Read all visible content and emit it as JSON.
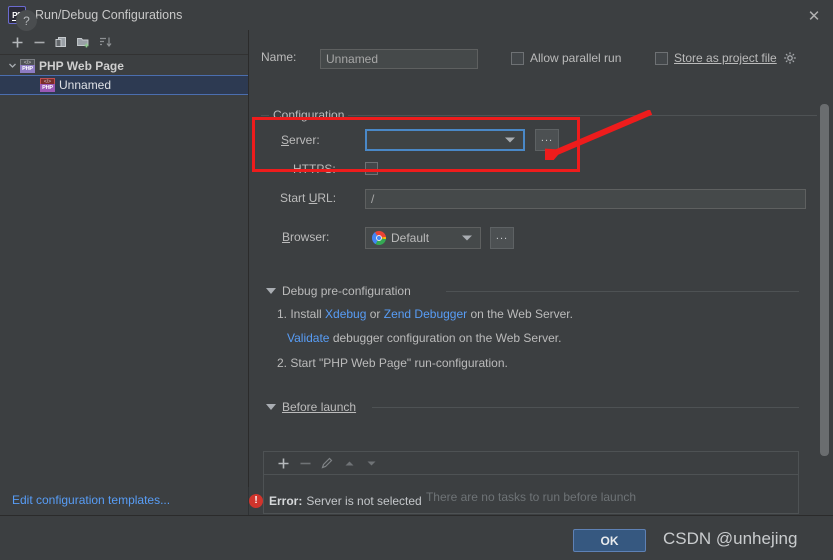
{
  "window": {
    "title": "Run/Debug Configurations",
    "app_icon": "phpstorm-icon",
    "close_icon": "✕"
  },
  "left_panel": {
    "toolbar": [
      {
        "name": "add-configuration-button",
        "icon": "plus-icon",
        "label": "+"
      },
      {
        "name": "remove-configuration-button",
        "icon": "minus-icon",
        "label": "−"
      },
      {
        "name": "copy-configuration-button",
        "icon": "copy-icon",
        "label": "copy"
      },
      {
        "name": "save-configuration-button",
        "icon": "save-folder-icon",
        "label": "save"
      },
      {
        "name": "sort-configurations-button",
        "icon": "sort-icon",
        "label": "sort"
      }
    ],
    "tree": [
      {
        "label": "PHP Web Page",
        "type": "group",
        "expanded": true,
        "icon": "php-web-page-icon"
      },
      {
        "label": "Unnamed",
        "type": "child",
        "selected": true,
        "icon": "php-web-page-icon"
      }
    ],
    "edit_templates_link": "Edit configuration templates..."
  },
  "form": {
    "name_label": "Name:",
    "name_value": "Unnamed",
    "name_placeholder": "Unnamed",
    "allow_parallel_run": "Allow parallel run",
    "allow_parallel_run_checked": false,
    "store_as_project_file": "Store as project file",
    "store_as_project_file_checked": false,
    "store_gear_icon": "gear-icon",
    "configuration_group_title": "Configuration",
    "server_label": "Server:",
    "server_value": "",
    "server_browse_label": "...",
    "https_label": "HTTPS:",
    "https_checked": false,
    "start_url_label": "Start URL:",
    "start_url_value": "/",
    "browser_label": "Browser:",
    "browser_value": "Default",
    "browser_icon": "chrome-icon",
    "browser_browse_label": "..."
  },
  "debug_section": {
    "title": "Debug pre-configuration",
    "expanded": true,
    "step1_prefix": "1. Install ",
    "step1_link1": "Xdebug",
    "step1_mid": " or ",
    "step1_link2": "Zend Debugger",
    "step1_suffix": " on the Web Server.",
    "step2_link": "Validate",
    "step2_suffix": " debugger configuration on the Web Server.",
    "step3": "2. Start \"PHP Web Page\" run-configuration."
  },
  "before_launch": {
    "title": "Before launch",
    "expanded": true,
    "toolbar": [
      {
        "name": "add-task-button",
        "icon": "plus-icon",
        "label": "+"
      },
      {
        "name": "remove-task-button",
        "icon": "minus-icon",
        "label": "−"
      },
      {
        "name": "edit-task-button",
        "icon": "pencil-icon",
        "label": "edit"
      },
      {
        "name": "move-task-up-button",
        "icon": "arrow-up-icon",
        "label": "up"
      },
      {
        "name": "move-task-down-button",
        "icon": "arrow-down-icon",
        "label": "down"
      }
    ],
    "empty_text": "There are no tasks to run before launch"
  },
  "status": {
    "error_icon": "error-icon",
    "error_label": "Error:",
    "error_message": "Server is not selected"
  },
  "footer": {
    "help_label": "?",
    "ok_label": "OK",
    "watermark": "CSDN @unhejing"
  },
  "colors": {
    "background": "#3c3f41",
    "selection": "#2d3a52",
    "link": "#589df6",
    "accent_button": "#365880",
    "error": "#d0342c",
    "annotation": "#ee1c1c"
  }
}
